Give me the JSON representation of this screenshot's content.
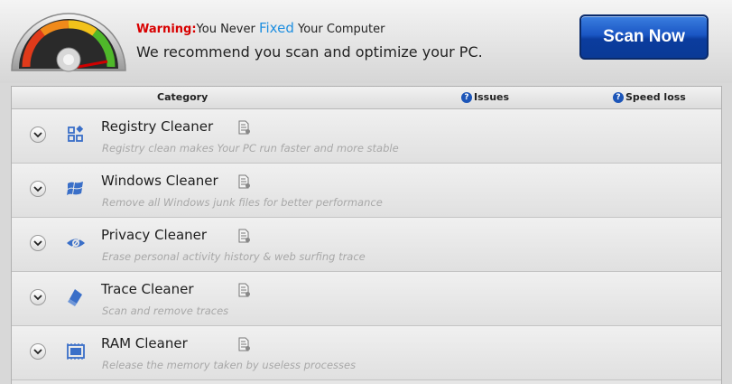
{
  "header": {
    "warning_prefix": "Warning:",
    "warning_part1": "You Never ",
    "warning_fixed": "Fixed",
    "warning_part2": " Your Computer",
    "recommend": "We recommend you scan and optimize your PC.",
    "scan_button": "Scan Now"
  },
  "table": {
    "columns": {
      "category": "Category",
      "issues": "Issues",
      "speed_loss": "Speed loss"
    },
    "rows": [
      {
        "title": "Registry Cleaner",
        "desc": "Registry clean makes Your PC run faster and more stable",
        "icon": "registry-icon"
      },
      {
        "title": "Windows Cleaner",
        "desc": "Remove all Windows junk files for better performance",
        "icon": "windows-icon"
      },
      {
        "title": "Privacy Cleaner",
        "desc": "Erase personal activity history & web surfing trace",
        "icon": "eye-icon"
      },
      {
        "title": "Trace Cleaner",
        "desc": "Scan and remove traces",
        "icon": "eraser-icon"
      },
      {
        "title": "RAM Cleaner",
        "desc": "Release the memory taken by useless processes",
        "icon": "ram-icon"
      }
    ]
  },
  "colors": {
    "warning": "#d80000",
    "fixed": "#1f8fe0",
    "button": "#1a56c4",
    "icon_blue": "#3a6fc8"
  }
}
